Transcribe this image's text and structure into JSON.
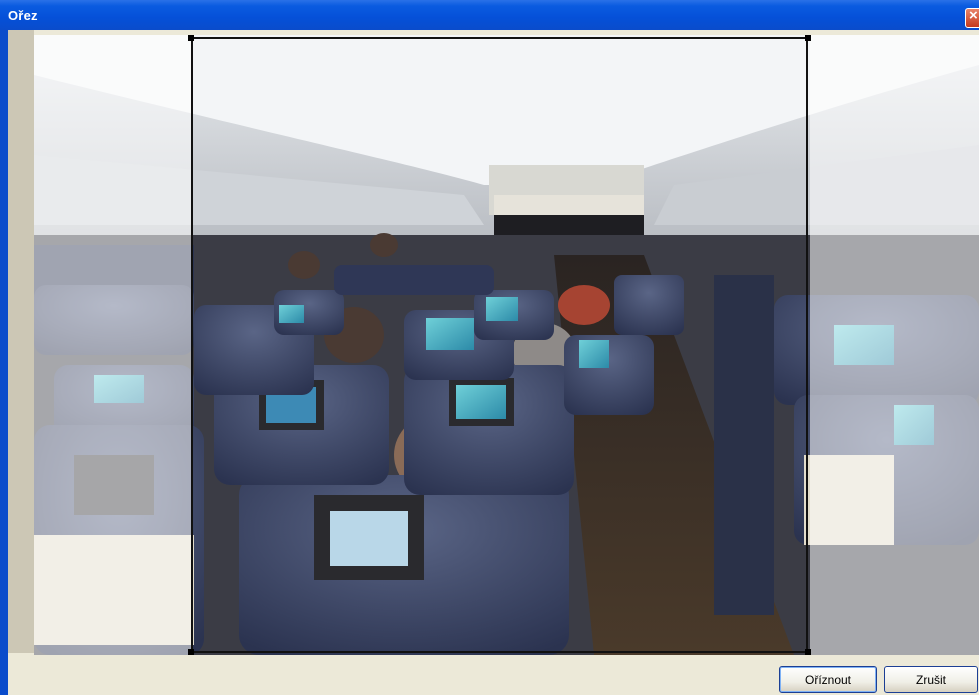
{
  "window": {
    "title": "Ořez",
    "close_label": "×"
  },
  "photo": {
    "description_icon": "airplane-cabin-photo"
  },
  "buttons": {
    "crop_label": "Oříznout",
    "cancel_label": "Zrušit"
  },
  "colors": {
    "titlebar": "#0a5be0",
    "dialog_bg": "#ece9d8",
    "crop_border": "#111111"
  }
}
